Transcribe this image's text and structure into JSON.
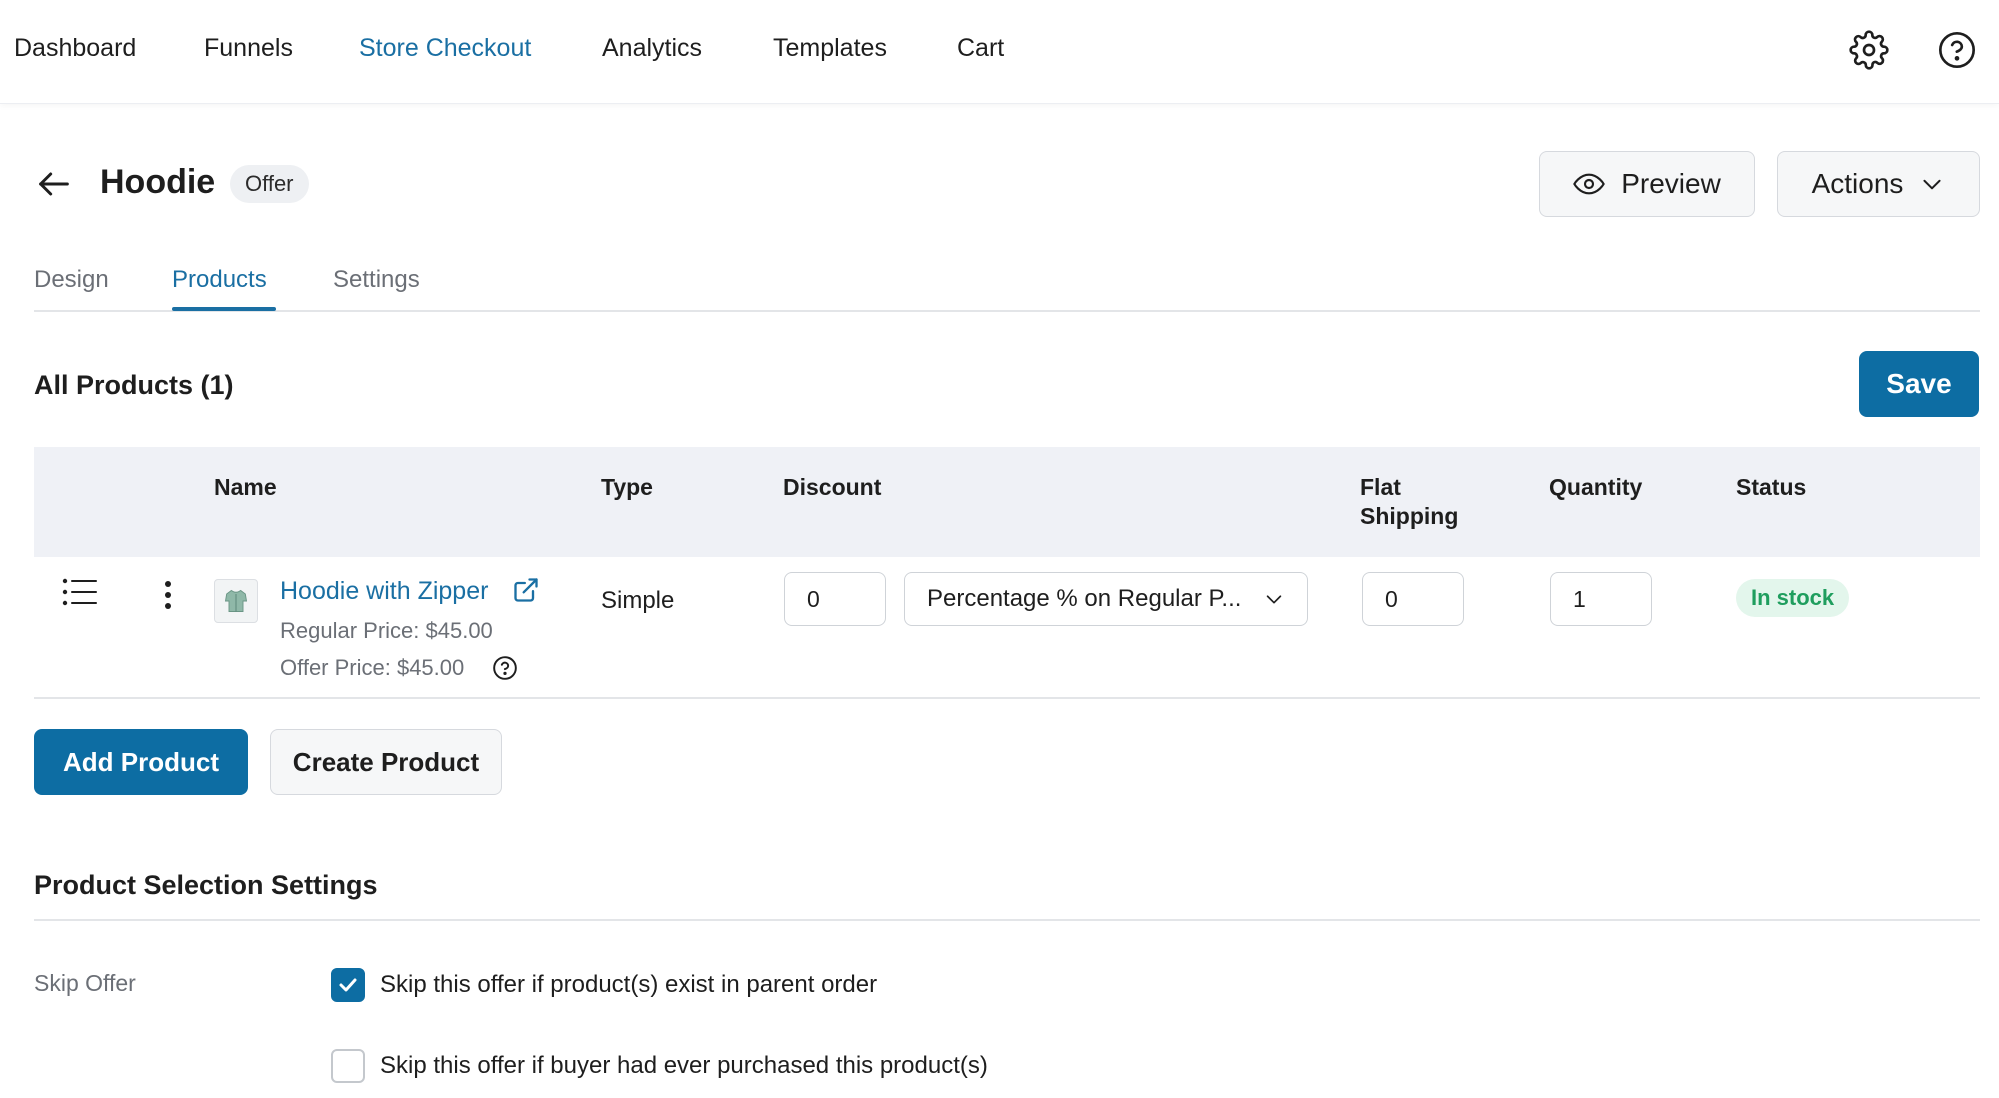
{
  "nav": {
    "items": [
      {
        "label": "Dashboard",
        "active": false
      },
      {
        "label": "Funnels",
        "active": false
      },
      {
        "label": "Store Checkout",
        "active": true
      },
      {
        "label": "Analytics",
        "active": false
      },
      {
        "label": "Templates",
        "active": false
      },
      {
        "label": "Cart",
        "active": false
      }
    ],
    "icons": [
      "gear-icon",
      "help-circle-icon"
    ]
  },
  "header": {
    "title": "Hoodie",
    "badge": "Offer",
    "preview_label": "Preview",
    "actions_label": "Actions"
  },
  "tabs": [
    {
      "label": "Design",
      "active": false
    },
    {
      "label": "Products",
      "active": true
    },
    {
      "label": "Settings",
      "active": false
    }
  ],
  "products": {
    "heading": "All Products (1)",
    "save_label": "Save",
    "columns": [
      "Name",
      "Type",
      "Discount",
      "Flat Shipping",
      "Quantity",
      "Status"
    ],
    "rows": [
      {
        "name": "Hoodie with Zipper",
        "regular_price": "Regular Price: $45.00",
        "offer_price": "Offer Price: $45.00",
        "type": "Simple",
        "discount_value": "0",
        "discount_type": "Percentage % on Regular P...",
        "flat_shipping": "0",
        "quantity": "1",
        "status": "In stock"
      }
    ],
    "add_product_label": "Add Product",
    "create_product_label": "Create Product"
  },
  "selection_settings": {
    "heading": "Product Selection Settings",
    "skip_offer_label": "Skip Offer",
    "options": [
      {
        "label": "Skip this offer if product(s) exist in parent order",
        "checked": true
      },
      {
        "label": "Skip this offer if buyer had ever purchased this product(s)",
        "checked": false
      }
    ]
  },
  "colors": {
    "accent": "#1a6fa3",
    "primary_button": "#0d6da3",
    "status_green": "#1f9e5e"
  }
}
